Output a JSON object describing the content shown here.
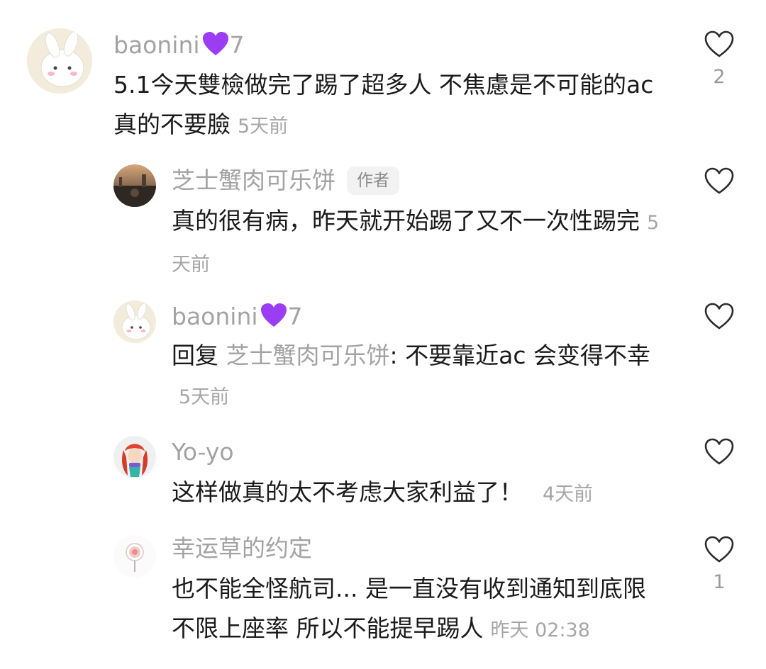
{
  "comments": [
    {
      "username": "baonini",
      "badge": "7",
      "text": "5.1今天雙檢做完了踢了超多人 不焦慮是不可能的ac 真的不要臉",
      "time": "5天前",
      "likes": "2"
    },
    {
      "username": "芝士蟹肉可乐饼",
      "author_tag": "作者",
      "text": "真的很有病，昨天就开始踢了又不一次性踢完",
      "time": "5天前"
    },
    {
      "username": "baonini",
      "badge": "7",
      "reply_prefix": "回复 ",
      "reply_to": "芝士蟹肉可乐饼",
      "text": ": 不要靠近ac 会变得不幸",
      "time": "5天前"
    },
    {
      "username": "Yo-yo",
      "text": "这样做真的太不考虑大家利益了！",
      "time": "4天前"
    },
    {
      "username": "幸运草的约定",
      "text": "也不能全怪航司... 是一直没有收到通知到底限不限上座率 所以不能提早踢人",
      "time": "昨天 02:38",
      "likes": "1"
    }
  ],
  "icons": {
    "like": "heart-outline-icon",
    "badge": "purple-heart-icon"
  },
  "colors": {
    "badge_purple": "#9b3df2",
    "text": "#1b1b1b",
    "muted": "#a3a3a3"
  }
}
